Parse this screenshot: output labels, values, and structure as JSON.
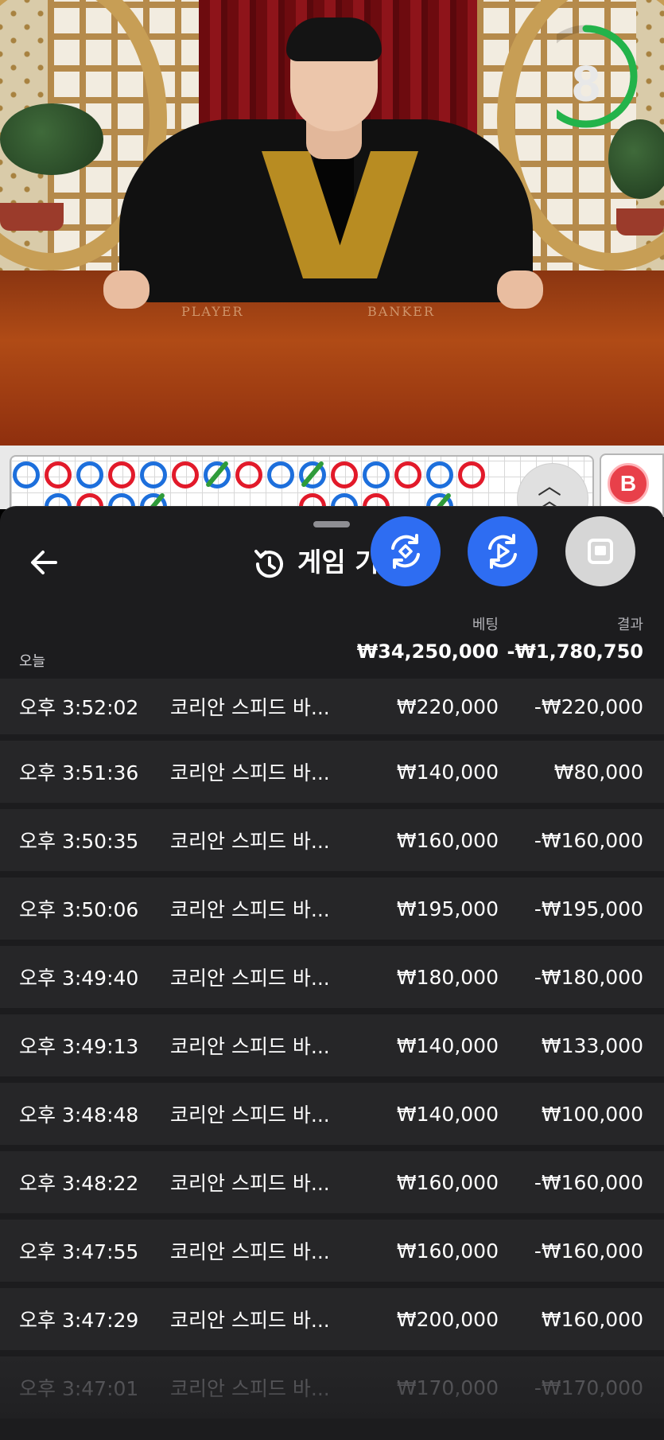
{
  "video": {
    "timer_value": "8",
    "timer_fraction": 0.7,
    "table_left_label": "PLAYER",
    "table_right_label": "BANKER"
  },
  "roadmap": {
    "badge_label": "B",
    "colors": {
      "player": "#1d6fdc",
      "banker": "#e21a2a",
      "tie": "#2f9b3a"
    }
  },
  "sheet": {
    "title": "게임 기록",
    "back_icon": "arrow-left-icon",
    "title_icon": "history-icon",
    "fab_icons": [
      "sync-icon",
      "play-sync-icon",
      "stop-icon"
    ],
    "colors": {
      "fab_blue": "#2e6df2",
      "sheet_bg": "#1c1c1e",
      "row_bg": "#262628"
    },
    "columns": {
      "bet": "베팅",
      "result": "결과"
    },
    "summary": {
      "label": "오늘",
      "bet_total": "₩34,250,000",
      "result_total": "-₩1,780,750"
    },
    "rows": [
      {
        "time": "오후 3:52:02",
        "game": "코리안 스피드 바...",
        "bet": "₩220,000",
        "result": "-₩220,000"
      },
      {
        "time": "오후 3:51:36",
        "game": "코리안 스피드 바...",
        "bet": "₩140,000",
        "result": "₩80,000"
      },
      {
        "time": "오후 3:50:35",
        "game": "코리안 스피드 바...",
        "bet": "₩160,000",
        "result": "-₩160,000"
      },
      {
        "time": "오후 3:50:06",
        "game": "코리안 스피드 바...",
        "bet": "₩195,000",
        "result": "-₩195,000"
      },
      {
        "time": "오후 3:49:40",
        "game": "코리안 스피드 바...",
        "bet": "₩180,000",
        "result": "-₩180,000"
      },
      {
        "time": "오후 3:49:13",
        "game": "코리안 스피드 바...",
        "bet": "₩140,000",
        "result": "₩133,000"
      },
      {
        "time": "오후 3:48:48",
        "game": "코리안 스피드 바...",
        "bet": "₩140,000",
        "result": "₩100,000"
      },
      {
        "time": "오후 3:48:22",
        "game": "코리안 스피드 바...",
        "bet": "₩160,000",
        "result": "-₩160,000"
      },
      {
        "time": "오후 3:47:55",
        "game": "코리안 스피드 바...",
        "bet": "₩160,000",
        "result": "-₩160,000"
      },
      {
        "time": "오후 3:47:29",
        "game": "코리안 스피드 바...",
        "bet": "₩200,000",
        "result": "₩160,000"
      },
      {
        "time": "오후 3:47:01",
        "game": "코리안 스피드 바...",
        "bet": "₩170,000",
        "result": "-₩170,000"
      }
    ]
  }
}
